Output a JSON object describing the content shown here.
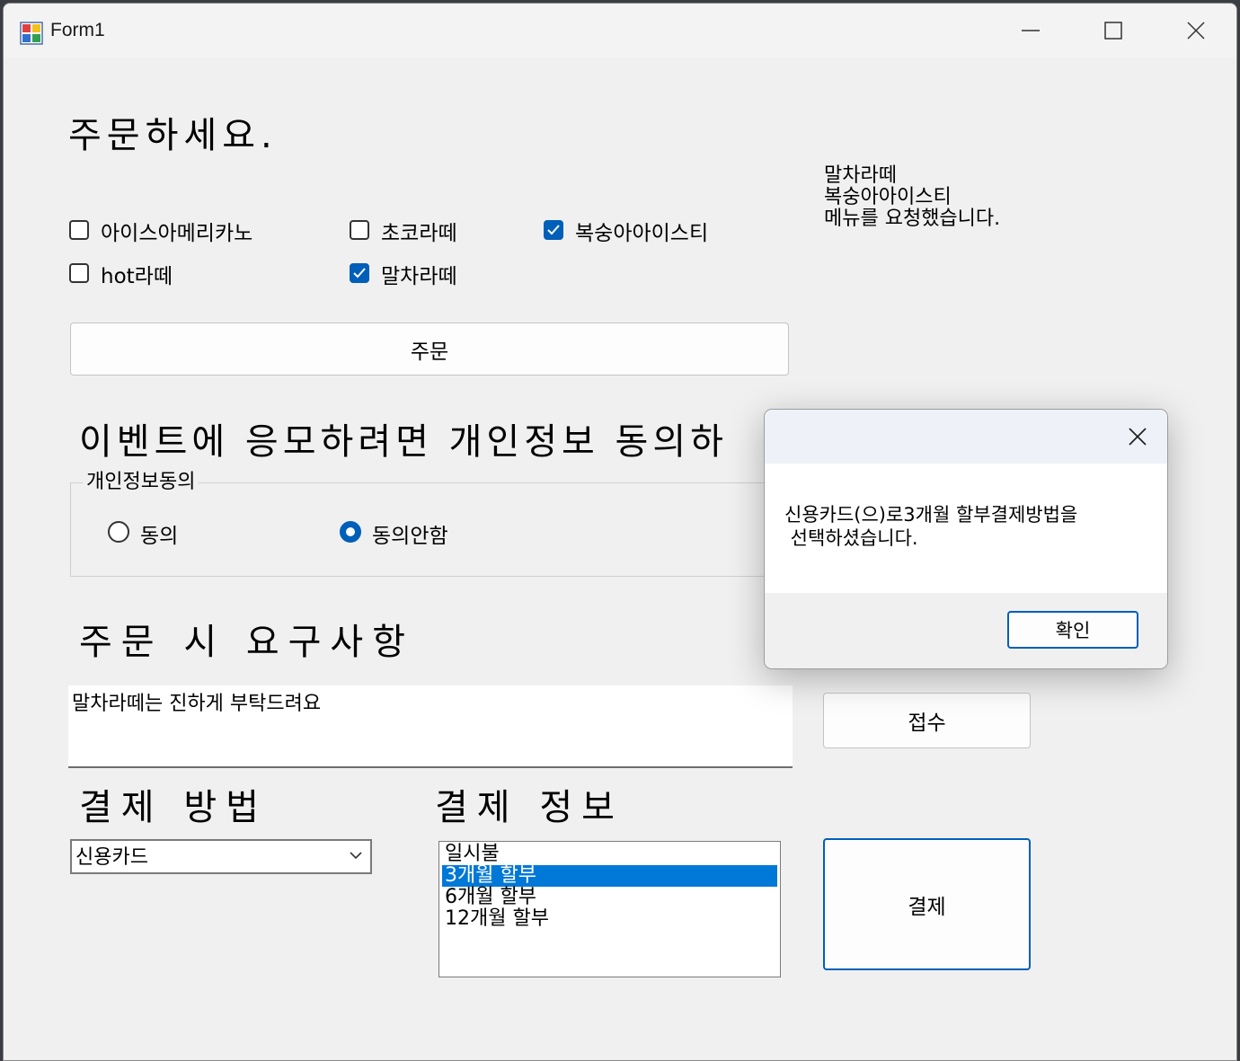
{
  "window": {
    "title": "Form1"
  },
  "order": {
    "heading": "주문하세요.",
    "items": [
      {
        "label": "아이스아메리카노",
        "checked": false
      },
      {
        "label": "초코라떼",
        "checked": false
      },
      {
        "label": "복숭아아이스티",
        "checked": true
      },
      {
        "label": "hot라떼",
        "checked": false
      },
      {
        "label": "말차라떼",
        "checked": true
      }
    ],
    "order_button": "주문",
    "result_text": "말차라떼\n복숭아아이스티\n메뉴를 요청했습니다."
  },
  "privacy": {
    "heading": "이벤트에 응모하려면 개인정보 동의하",
    "group_title": "개인정보동의",
    "options": [
      {
        "label": "동의",
        "selected": false
      },
      {
        "label": "동의안함",
        "selected": true
      }
    ]
  },
  "request": {
    "heading": "주문 시 요구사항",
    "text": "말차라떼는 진하게 부탁드려요",
    "submit_button": "접수"
  },
  "payment": {
    "method_heading": "결제 방법",
    "method_selected": "신용카드",
    "info_heading": "결제 정보",
    "info_options": [
      "일시불",
      "3개월 할부",
      "6개월 할부",
      "12개월 할부"
    ],
    "info_selected_index": 1,
    "pay_button": "결제"
  },
  "dialog": {
    "message": "신용카드(으)로3개월 할부결제방법을\n 선택하셨습니다.",
    "ok_button": "확인"
  }
}
